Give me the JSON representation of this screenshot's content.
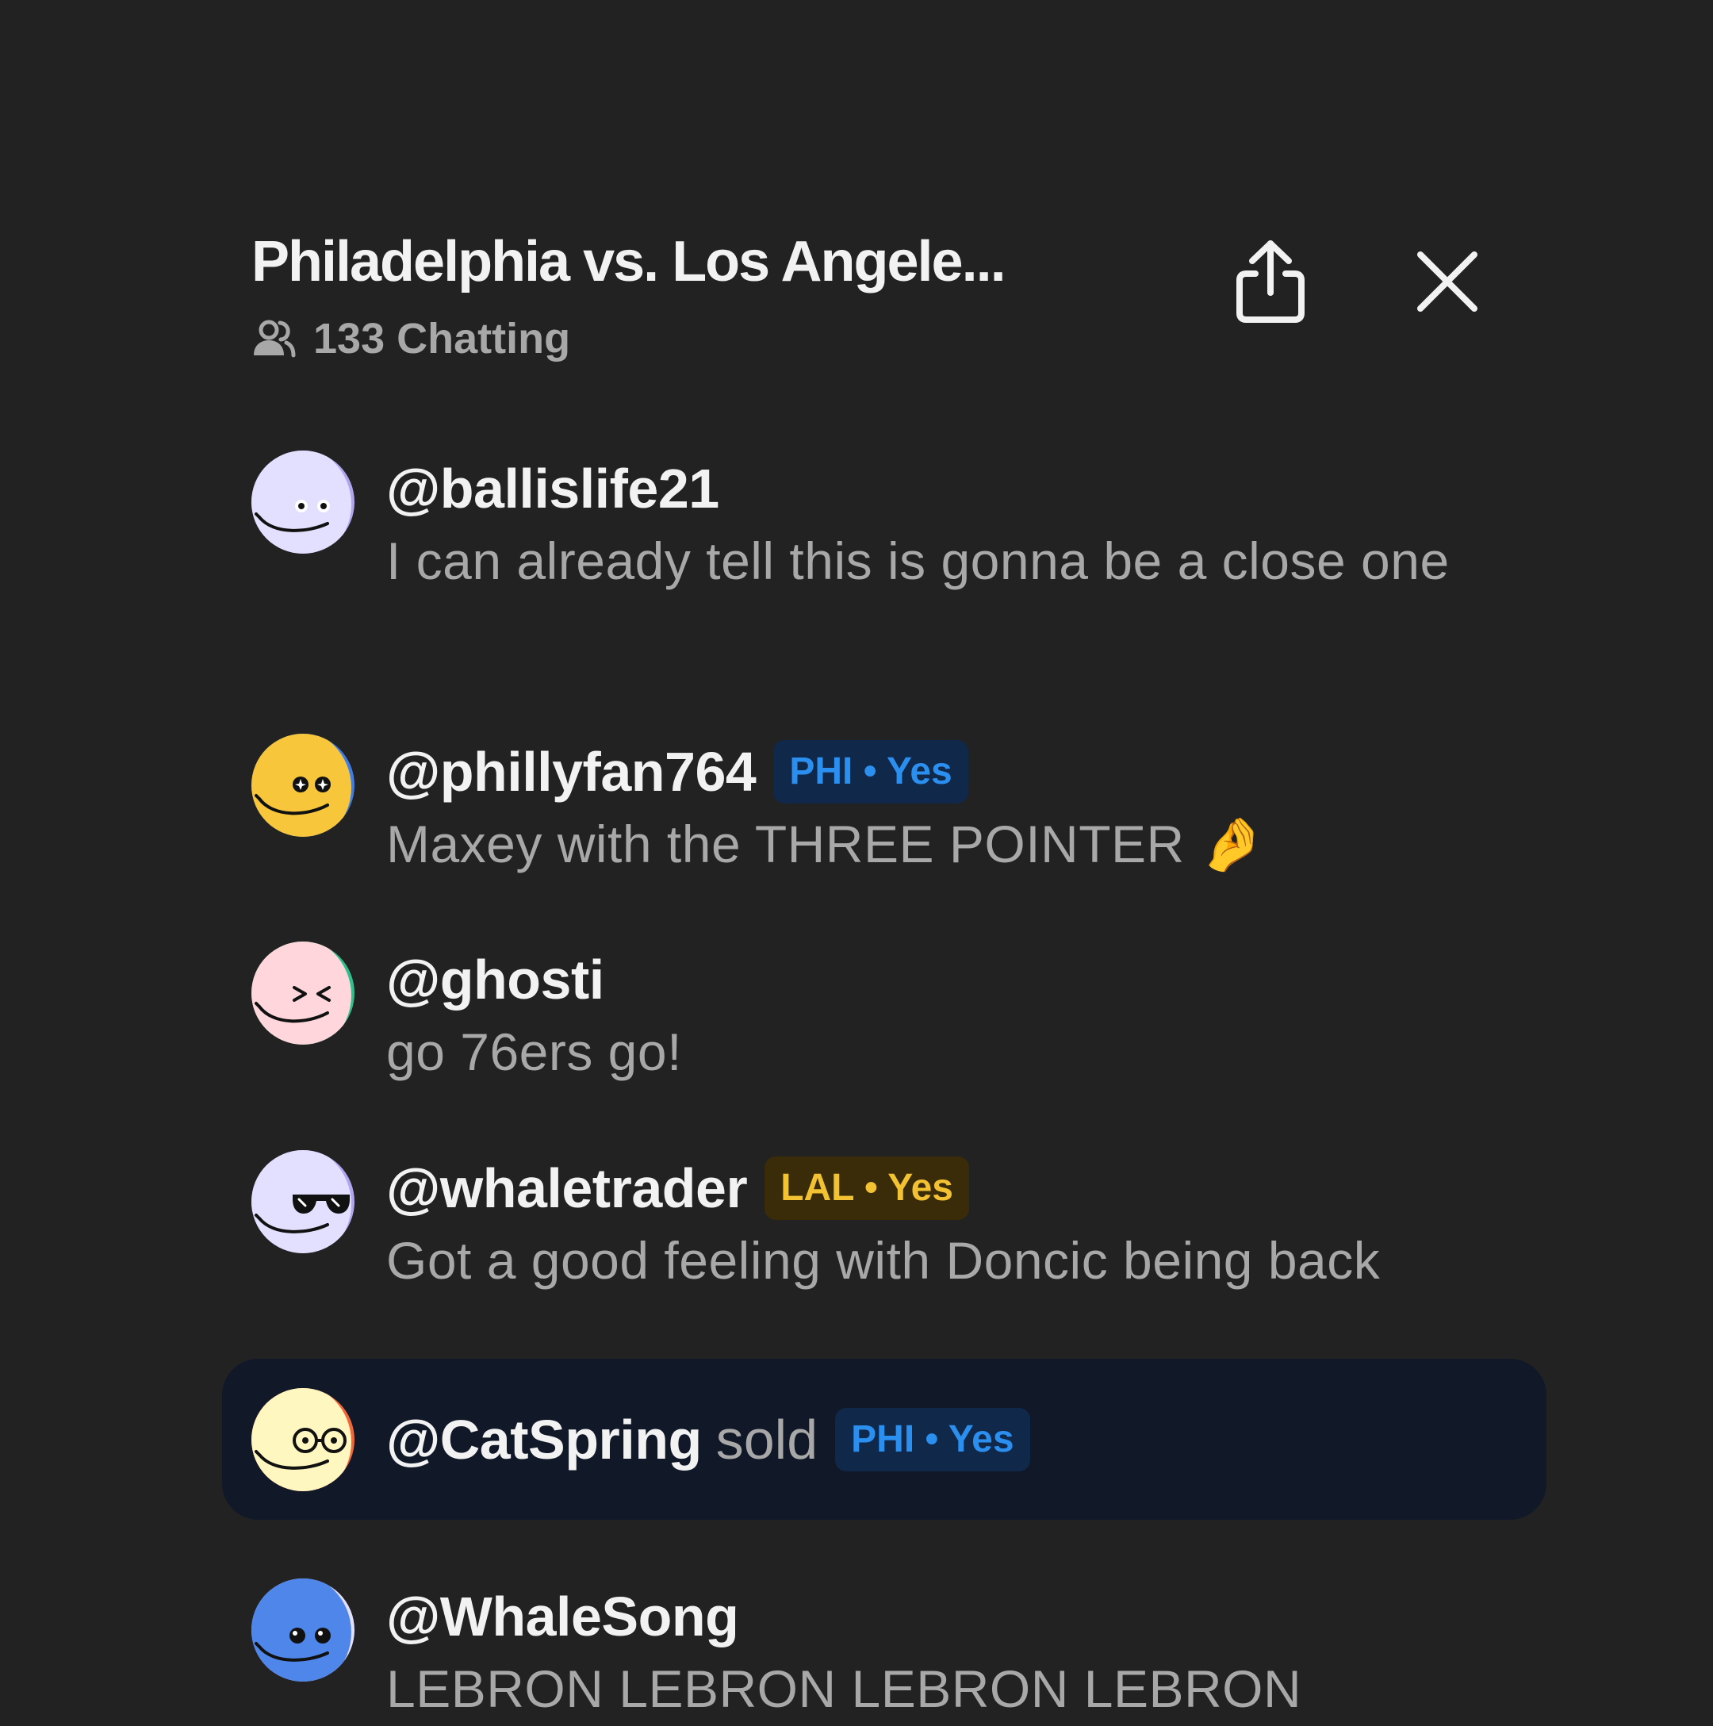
{
  "header": {
    "title": "Philadelphia vs. Los Angele...",
    "chatting": "133 Chatting",
    "icons": {
      "users": "users-icon",
      "share": "share-icon",
      "close": "close-icon"
    }
  },
  "messages": [
    {
      "username": "@ballislife21",
      "text": "I can already tell this is gonna be a close one"
    },
    {
      "username": "@phillyfan764",
      "badge": "PHI • Yes",
      "text": "Maxey with the THREE POINTER 🤌"
    },
    {
      "username": "@ghosti",
      "text": "go 76ers go!"
    },
    {
      "username": "@whaletrader",
      "badge": "LAL • Yes",
      "text": "Got a good feeling with Doncic being back"
    },
    {
      "username": "@WhaleSong",
      "text": "LEBRON LEBRON LEBRON LEBRON"
    }
  ],
  "trade": {
    "username": "@CatSpring",
    "action": "sold",
    "badge": "PHI • Yes"
  },
  "colors": {
    "background": "#222222",
    "phi_badge_bg": "#10284a",
    "phi_badge_text": "#2b8ff0",
    "lal_badge_bg": "#3a2c09",
    "lal_badge_text": "#f2c233",
    "trade_card": "#111827"
  }
}
